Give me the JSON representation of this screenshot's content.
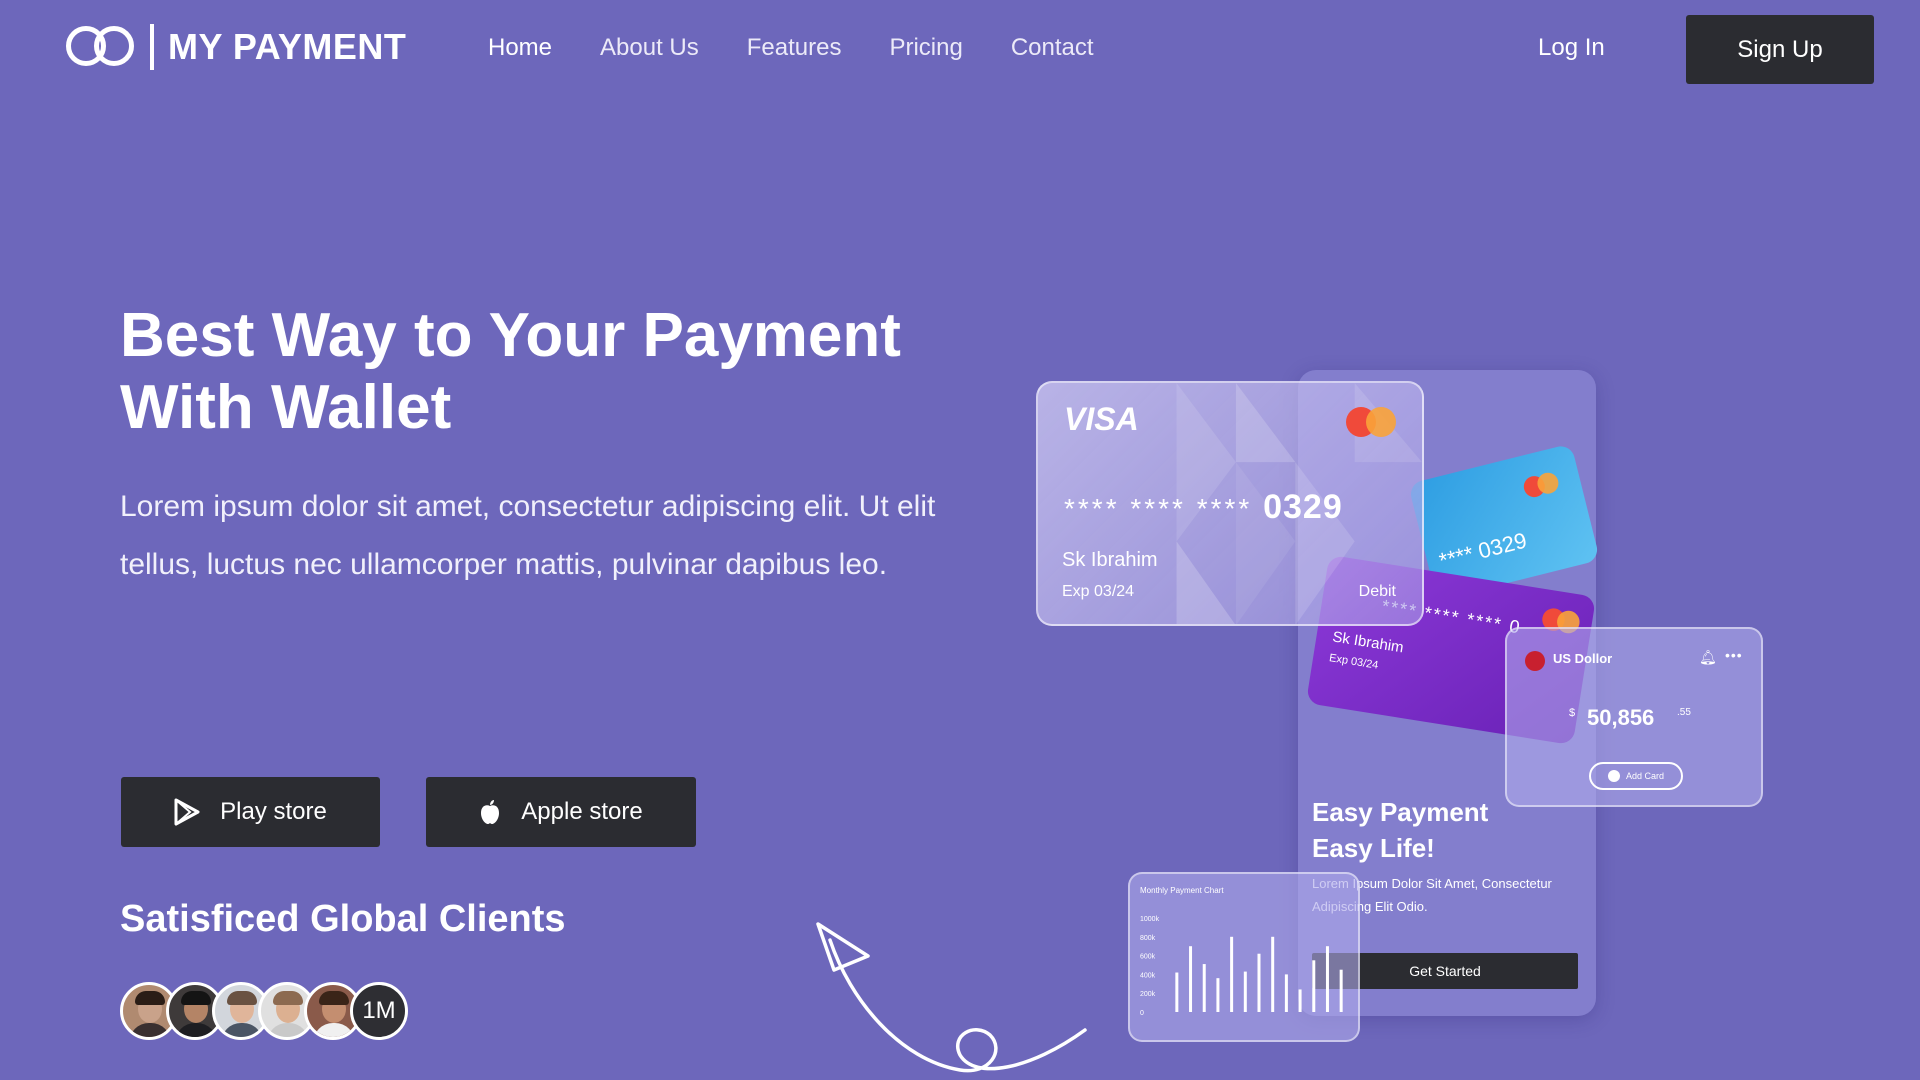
{
  "brand": {
    "name": "MY PAYMENT"
  },
  "nav": {
    "links": [
      "Home",
      "About Us",
      "Features",
      "Pricing",
      "Contact"
    ],
    "active": "Home",
    "login_label": "Log In",
    "signup_label": "Sign Up"
  },
  "hero": {
    "title_line1": "Best Way to Your Payment",
    "title_line2": "With Wallet",
    "description": "Lorem ipsum dolor sit amet, consectetur adipiscing elit. Ut elit tellus, luctus nec ullamcorper mattis, pulvinar dapibus leo.",
    "play_store_label": "Play store",
    "apple_store_label": "Apple store",
    "clients_title": "Satisficed Global Clients",
    "clients_count": "1M"
  },
  "mockup": {
    "card_main": {
      "brand": "VISA",
      "masked": "****  ****  ****",
      "last4": "0329",
      "holder": "Sk Ibrahim",
      "exp": "Exp  03/24",
      "type": "Debit"
    },
    "card_blue": {
      "number": "**** 0329"
    },
    "card_purple": {
      "number": "****  ****  ****  0",
      "holder": "Sk Ibrahim",
      "exp": "Exp  03/24"
    },
    "balance": {
      "currency": "US Dollor",
      "symbol": "$",
      "amount": "50,856",
      "change": ".55",
      "add_card_label": "Add Card"
    },
    "promo": {
      "title_line1": "Easy Payment",
      "title_line2": "Easy Life!",
      "description": "Lorem Ipsum Dolor Sit Amet, Consectetur Adipiscing Elit Odio.",
      "cta_label": "Get Started"
    },
    "chart": {
      "title": "Monthly Payment Chart"
    }
  },
  "chart_data": {
    "type": "bar",
    "title": "Monthly Payment Chart",
    "y_ticks": [
      "1000k",
      "800k",
      "600k",
      "400k",
      "200k",
      "0"
    ],
    "ylim": [
      0,
      1000
    ],
    "values": [
      420,
      700,
      510,
      360,
      800,
      430,
      620,
      800,
      400,
      240,
      550,
      700,
      450
    ]
  },
  "colors": {
    "background": "#6d67bb",
    "button_dark": "#2b2c31",
    "card_blue": "#3aa8e8",
    "card_purple": "#7a2ec8"
  },
  "icons": {
    "play_store": "play-triangle-icon",
    "apple_store": "apple-logo-icon",
    "logo": "double-ring-logo-icon"
  }
}
